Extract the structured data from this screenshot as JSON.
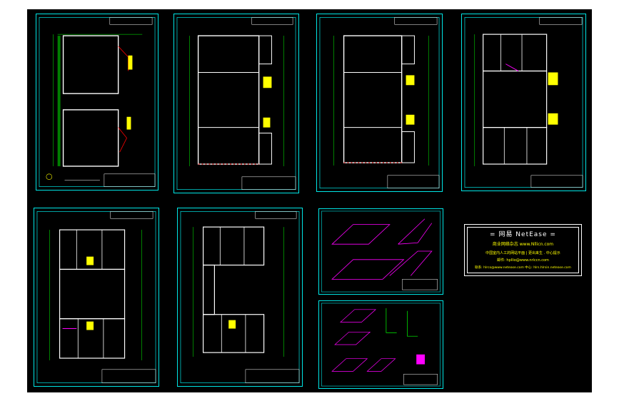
{
  "window": {
    "background": "#000000",
    "frame_color": "#00e6e6"
  },
  "sheets": [
    {
      "id": "sheet-1",
      "kind": "floor-plan",
      "variant": "twin"
    },
    {
      "id": "sheet-2",
      "kind": "floor-plan",
      "variant": "hall"
    },
    {
      "id": "sheet-3",
      "kind": "floor-plan",
      "variant": "hall"
    },
    {
      "id": "sheet-4",
      "kind": "floor-plan",
      "variant": "rooms"
    },
    {
      "id": "sheet-5",
      "kind": "floor-plan",
      "variant": "rooms-tall"
    },
    {
      "id": "sheet-6",
      "kind": "floor-plan",
      "variant": "rooms-narrow"
    },
    {
      "id": "sheet-7",
      "kind": "isometric",
      "variant": "pipes-a"
    },
    {
      "id": "sheet-8",
      "kind": "isometric",
      "variant": "pipes-b"
    }
  ],
  "watermark": {
    "title": "= 网易 NetEase =",
    "line1": "商业网络杂志 www.Nllicn.com",
    "line2": "中国室内人工的网站平面 | 更出来生 . 中心提示",
    "line3": "邮件: hpllio@www.nrlccn.com",
    "line4": "联系: hlrco@www.netease.com 中心: hlrs.hlrsin.netease.com"
  },
  "colors": {
    "wall": "#ffffff",
    "dim": "#00ff00",
    "accent": "#ff0000",
    "text": "#ffff00",
    "door": "#ff00ff"
  }
}
